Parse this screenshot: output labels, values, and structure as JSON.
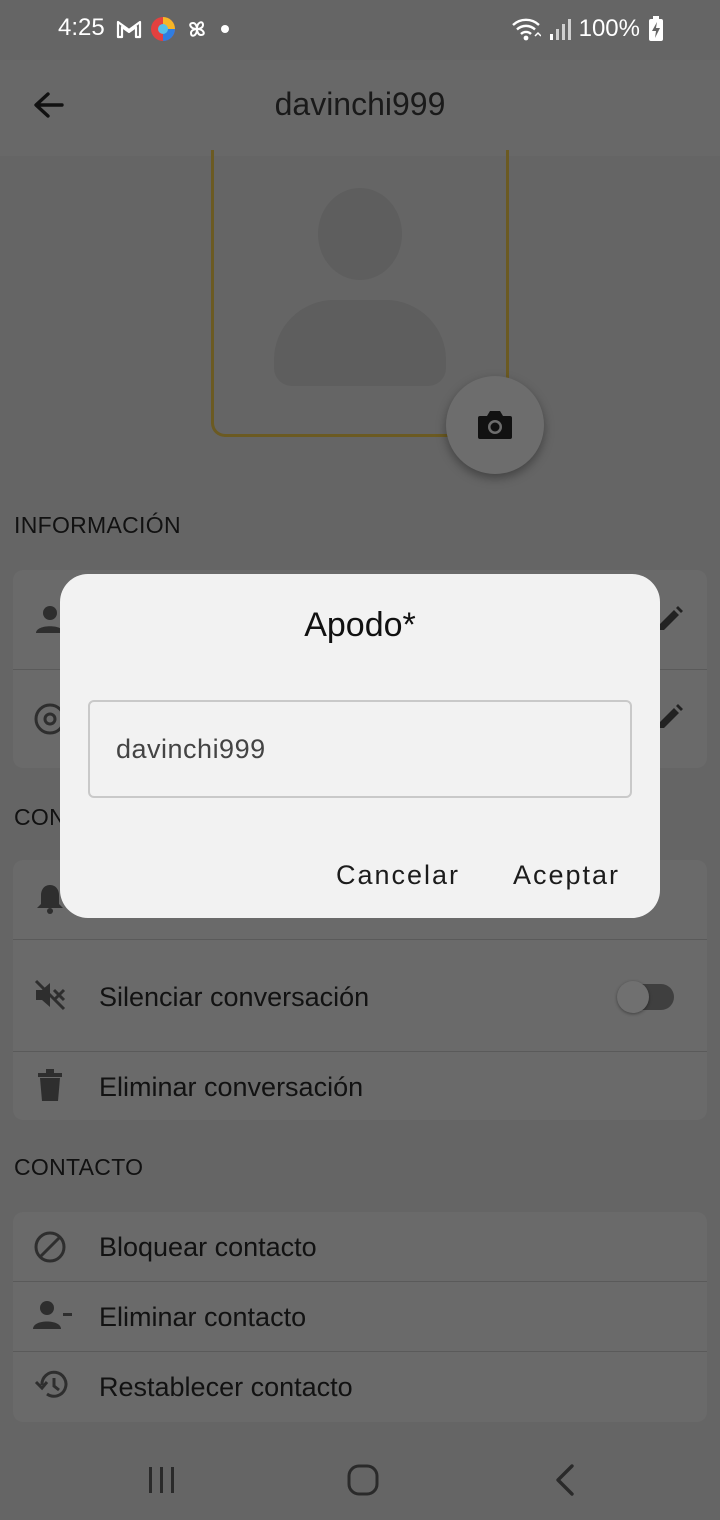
{
  "status_bar": {
    "time": "4:25",
    "battery": "100%",
    "icons": [
      "gmail-icon",
      "browser-icon",
      "pinwheel-icon",
      "dot-icon",
      "wifi-icon",
      "signal-icon",
      "battery-charging-icon"
    ]
  },
  "app_bar": {
    "title": "davinchi999",
    "back_icon": "arrow-left-icon"
  },
  "avatar": {
    "camera_icon": "camera-icon"
  },
  "sections": {
    "info_title": "INFORMACIÓN",
    "conversation_title": "CON",
    "contact_title": "CONTACTO"
  },
  "conversation": {
    "mute_label": "Silenciar conversación",
    "mute_on": false,
    "delete_label": "Eliminar conversación"
  },
  "contact": {
    "block_label": "Bloquear contacto",
    "remove_label": "Eliminar contacto",
    "restore_label": "Restablecer contacto"
  },
  "dialog": {
    "title": "Apodo*",
    "input_value": "davinchi999",
    "cancel_label": "Cancelar",
    "accept_label": "Aceptar"
  },
  "colors": {
    "scrim_background": "#656565",
    "dialog_background": "#f2f2f2",
    "avatar_border": "#6b5a22"
  }
}
